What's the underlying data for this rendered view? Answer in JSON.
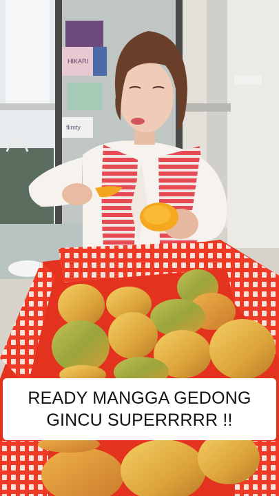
{
  "photo": {
    "subject": "woman-tasting-mango",
    "props": [
      "mango-crate",
      "storefront-window",
      "shopping-bag"
    ]
  },
  "caption": {
    "line1": "READY MANGGA GEDONG",
    "line2": "GINCU SUPERRRRR !!"
  },
  "shop_signs": {
    "box_label_1": "HIKARI",
    "box_label_2": "flimty"
  },
  "colors": {
    "crate": "#ef3b26",
    "mango_yellow": "#e7b94a",
    "mango_green": "#9aa53c",
    "vest_red": "#e64b55",
    "caption_bg": "#ffffff"
  }
}
